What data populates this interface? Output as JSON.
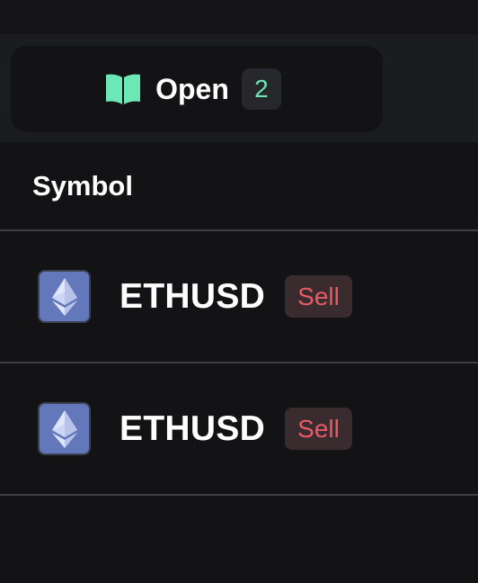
{
  "tabs": {
    "open": {
      "label": "Open",
      "count": "2",
      "icon": "book-open-icon"
    }
  },
  "table": {
    "columns": {
      "symbol": "Symbol"
    },
    "rows": [
      {
        "symbol": "ETHUSD",
        "side": "Sell",
        "icon": "ethereum-icon"
      },
      {
        "symbol": "ETHUSD",
        "side": "Sell",
        "icon": "ethereum-icon"
      }
    ]
  },
  "colors": {
    "background": "#131315",
    "accent_green": "#6ee7b7",
    "sell_red": "#e85a66",
    "eth_tile": "#6278ba"
  }
}
